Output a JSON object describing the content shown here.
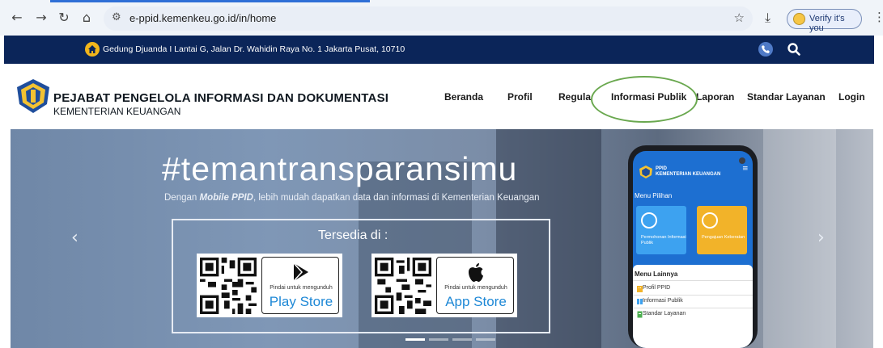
{
  "browser": {
    "url": "e-ppid.kemenkeu.go.id/in/home",
    "verify_label": "Verify it's you"
  },
  "topbar": {
    "address": "Gedung Djuanda I Lantai G, Jalan Dr. Wahidin Raya No. 1 Jakarta Pusat, 10710"
  },
  "header": {
    "title": "PEJABAT PENGELOLA INFORMASI DAN DOKUMENTASI",
    "subtitle": "KEMENTERIAN KEUANGAN",
    "nav": [
      "Beranda",
      "Profil",
      "Regulasi",
      "Informasi Publik",
      "Laporan",
      "Standar Layanan",
      "Login"
    ]
  },
  "hero": {
    "hashtag": "#temantransparansimu",
    "tagline_pre": "Dengan ",
    "tagline_bold": "Mobile PPID",
    "tagline_post": ", lebih mudah dapatkan data dan informasi di Kementerian Keuangan",
    "available": "Tersedia di :",
    "play_small": "Pindai untuk mengunduh",
    "play_name": "Play Store",
    "app_small": "Pindai untuk mengunduh",
    "app_name": "App Store",
    "prev": "‹",
    "next": "›"
  },
  "phone": {
    "brand_line1": "PPID",
    "brand_line2": "KEMENTERIAN KEUANGAN",
    "menu_title": "Menu Pilihan",
    "tile1": "Permohonan Informasi Publik",
    "tile2": "Pengajuan Keberatan",
    "more_title": "Menu Lainnya",
    "items": [
      "Profil PPID",
      "Informasi Publik",
      "Standar Layanan"
    ]
  },
  "colors": {
    "navy": "#0b2559",
    "highlight": "#6aa84f",
    "store_blue": "#1e88d6"
  }
}
